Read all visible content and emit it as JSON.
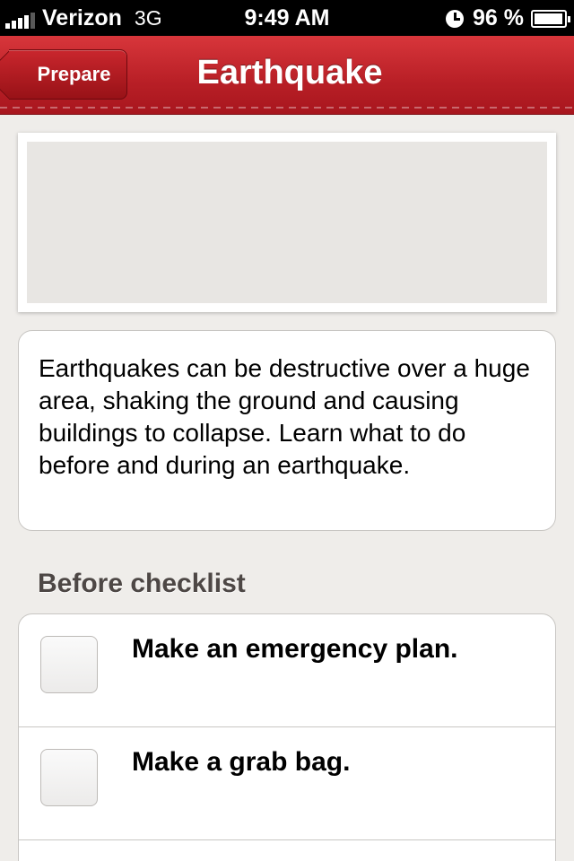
{
  "status_bar": {
    "carrier": "Verizon",
    "network": "3G",
    "time": "9:49 AM",
    "battery": "96 %",
    "battery_level": 0.96
  },
  "nav": {
    "back_label": "Prepare",
    "title": "Earthquake"
  },
  "description": "Earthquakes can be destructive over a huge area, shaking the ground and causing buildings to collapse. Learn what to do before and during an earthquake.",
  "before_checklist": {
    "title": "Before checklist",
    "items": [
      {
        "label": "Make an emergency plan.",
        "checked": false
      },
      {
        "label": "Make a grab bag.",
        "checked": false
      }
    ]
  },
  "colors": {
    "nav_red": "#b81f26",
    "background": "#efedea"
  }
}
